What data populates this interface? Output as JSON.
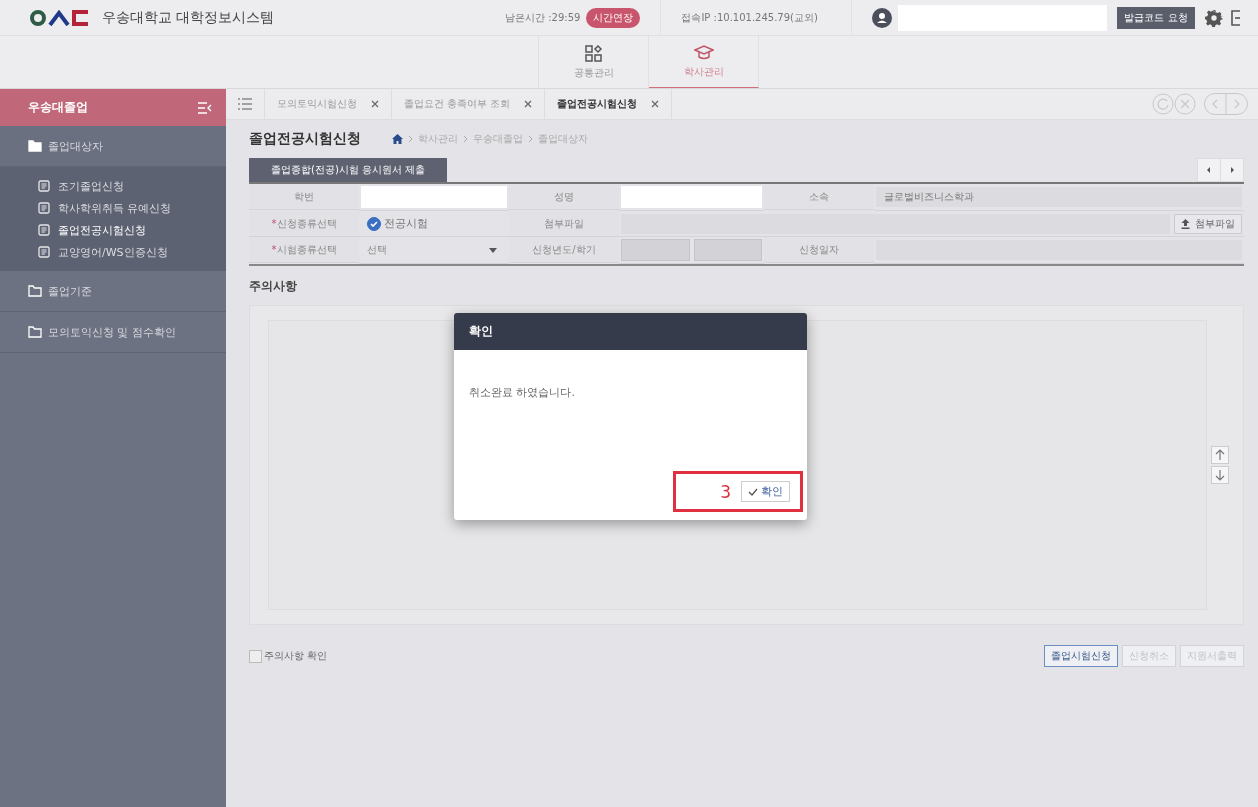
{
  "header": {
    "system_title": "우송대학교 대학정보시스템",
    "remaining_time": "남은시간 :29:59",
    "extend_button": "시간연장",
    "ip": "접속IP :10.101.245.79(교외)",
    "code_button": "발급코드 요청"
  },
  "nav": [
    {
      "label": "공통관리",
      "selected": false
    },
    {
      "label": "학사관리",
      "selected": true
    }
  ],
  "sidebar": {
    "title": "우송대졸업",
    "groups": [
      {
        "label": "졸업대상자",
        "expanded": true,
        "children": [
          {
            "label": "조기졸업신청",
            "selected": false
          },
          {
            "label": "학사학위취득 유예신청",
            "selected": false
          },
          {
            "label": "졸업전공시험신청",
            "selected": true
          },
          {
            "label": "교양영어/WS인증신청",
            "selected": false
          }
        ]
      },
      {
        "label": "졸업기준",
        "expanded": false
      },
      {
        "label": "모의토익신청 및 점수확인",
        "expanded": false
      }
    ]
  },
  "tabs": [
    {
      "label": "모의토익시험신청",
      "selected": false
    },
    {
      "label": "졸업요건 충족여부 조회",
      "selected": false
    },
    {
      "label": "졸업전공시험신청",
      "selected": true
    }
  ],
  "page": {
    "title": "졸업전공시험신청",
    "breadcrumb": [
      "학사관리",
      "우송대졸업",
      "졸업대상자"
    ]
  },
  "form": {
    "section_tab": "졸업종합(전공)시험 응시원서 제출",
    "student_no": {
      "label": "학번"
    },
    "name": {
      "label": "성명"
    },
    "department": {
      "label": "소속",
      "value": "글로벌비즈니스학과"
    },
    "apply_type": {
      "required_mark": "*",
      "label": "신청종류선택",
      "option": "전공시험",
      "checked": true
    },
    "attachment": {
      "label": "첨부파일",
      "button": "첨부파일"
    },
    "exam_type": {
      "required_mark": "*",
      "label": "시험종류선택",
      "value": "선택"
    },
    "term": {
      "label": "신청년도/학기"
    },
    "apply_date": {
      "label": "신청일자"
    }
  },
  "notice": {
    "heading": "주의사항"
  },
  "agree": {
    "label": "주의사항 확인",
    "checked": false
  },
  "actions": [
    {
      "label": "졸업시험신청",
      "disabled": false
    },
    {
      "label": "신청취소",
      "disabled": true
    },
    {
      "label": "지원서출력",
      "disabled": true
    }
  ],
  "dialog": {
    "title": "확인",
    "message": "취소완료 하였습니다.",
    "ok_button": "확인",
    "annotation": "3"
  }
}
